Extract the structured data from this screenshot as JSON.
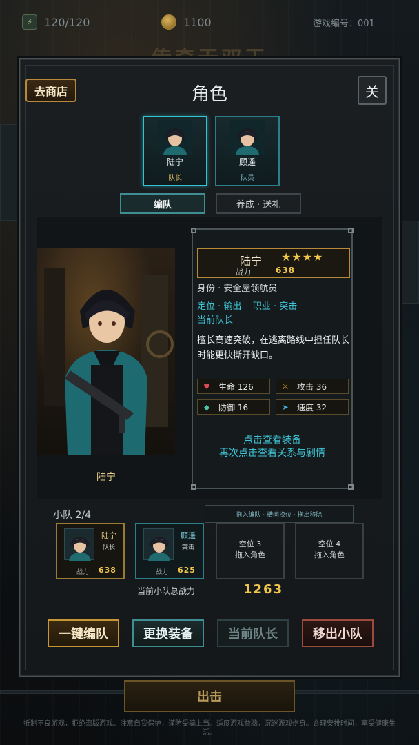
{
  "topbar": {
    "energy": "120/120",
    "coins": "1100",
    "game_id": "游戏编号：001"
  },
  "background_title": "传奇无双王",
  "panel": {
    "title": "角色",
    "shop_button": "去商店",
    "close_button": "关"
  },
  "characters": [
    {
      "name": "陆宁",
      "role": "队长"
    },
    {
      "name": "顾遥",
      "role": "队员"
    }
  ],
  "sub_tabs": [
    {
      "label": "编队"
    },
    {
      "label": "养成 · 送礼"
    }
  ],
  "portrait_name": "陆宁",
  "info": {
    "name": "陆宁",
    "stars": "★★★★",
    "cp_label": "战力",
    "cp_value": "638",
    "identity": "身份 · 安全屋领航员",
    "position_job": "定位 · 输出    职业 · 突击",
    "status": "当前队长",
    "description": "擅长高速突破，在逃离路线中担任队长时能更快撕开缺口。",
    "stats": [
      {
        "label": "生命 126",
        "icon": "heart-icon",
        "color": "#e04b5a"
      },
      {
        "label": "攻击 36",
        "icon": "swords-icon",
        "color": "#e0a03a"
      },
      {
        "label": "防御 16",
        "icon": "shield-icon",
        "color": "#4ac7a6"
      },
      {
        "label": "速度 32",
        "icon": "arrow-icon",
        "color": "#3fb5e0"
      }
    ],
    "hint_line1": "点击查看装备",
    "hint_line2": "再次点击查看关系与剧情"
  },
  "squad": {
    "label": "小队 2/4",
    "drag_hint": "拖入编队 · 槽间换位 · 拖出移除",
    "slots": [
      {
        "name": "陆宁",
        "role": "队长",
        "cp_label": "战力",
        "cp": "638"
      },
      {
        "name": "顾遥",
        "role": "突击",
        "cp_label": "战力",
        "cp": "625"
      },
      {
        "empty_title": "空位 3",
        "empty_hint": "拖入角色"
      },
      {
        "empty_title": "空位 4",
        "empty_hint": "拖入角色"
      }
    ],
    "total_label": "当前小队总战力",
    "total_value": "1263"
  },
  "actions": [
    {
      "label": "一键编队"
    },
    {
      "label": "更换装备"
    },
    {
      "label": "当前队长"
    },
    {
      "label": "移出小队"
    }
  ],
  "attack_button": "出击",
  "footer": "抵制不良游戏，拒绝盗版游戏。注意自我保护，谨防受骗上当。适度游戏益脑，沉迷游戏伤身。合理安排时间，享受健康生活。"
}
